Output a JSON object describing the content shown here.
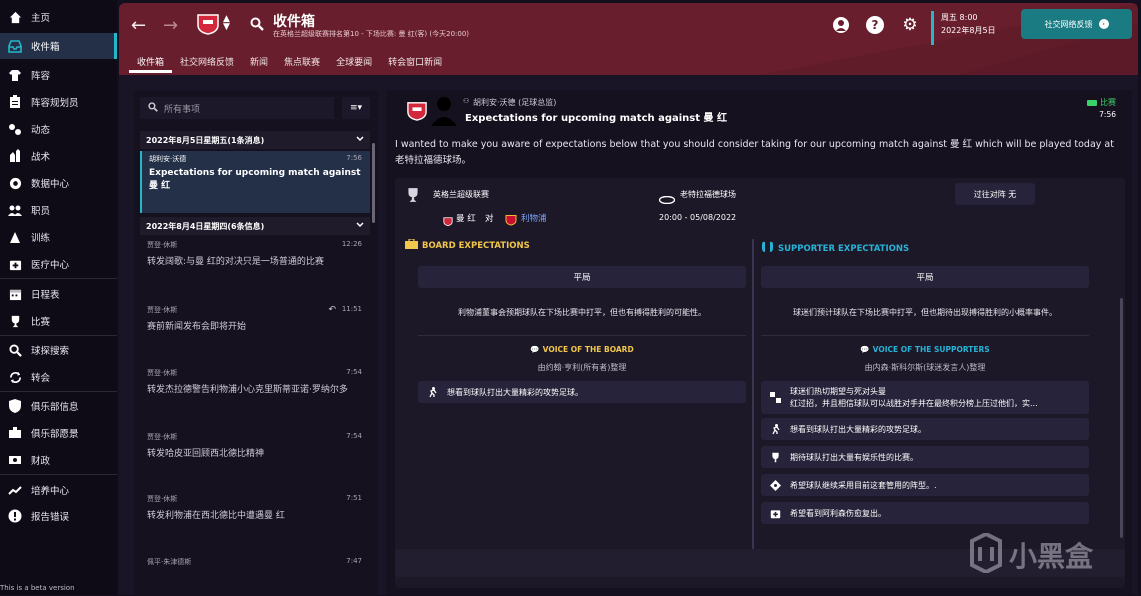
{
  "sidebar": {
    "items": [
      {
        "label": "主页",
        "icon": "home-icon"
      },
      {
        "label": "收件箱",
        "icon": "inbox-icon"
      },
      {
        "label": "阵容",
        "icon": "shirt-icon"
      },
      {
        "label": "阵容规划员",
        "icon": "clipboard-icon"
      },
      {
        "label": "动态",
        "icon": "dynamics-icon"
      },
      {
        "label": "战术",
        "icon": "tactics-icon"
      },
      {
        "label": "数据中心",
        "icon": "data-hub-icon"
      },
      {
        "label": "职员",
        "icon": "staff-icon"
      },
      {
        "label": "训练",
        "icon": "training-icon"
      },
      {
        "label": "医疗中心",
        "icon": "medical-icon"
      },
      {
        "label": "日程表",
        "icon": "calendar-icon"
      },
      {
        "label": "比赛",
        "icon": "trophy-icon"
      },
      {
        "label": "球探搜索",
        "icon": "search-icon"
      },
      {
        "label": "转会",
        "icon": "transfer-icon"
      },
      {
        "label": "俱乐部信息",
        "icon": "shield-icon"
      },
      {
        "label": "俱乐部愿景",
        "icon": "vision-icon"
      },
      {
        "label": "财政",
        "icon": "money-icon"
      },
      {
        "label": "培养中心",
        "icon": "development-icon"
      },
      {
        "label": "报告错误",
        "icon": "report-error-icon"
      }
    ],
    "beta": "This is a beta version"
  },
  "header": {
    "title": "收件箱",
    "subtitle": "在英格兰超级联赛排名第10 - 下场比赛: 曼 红(客) (今天20:00)",
    "tabs": [
      "收件箱",
      "社交网络反馈",
      "新闻",
      "焦点联赛",
      "全球要闻",
      "转会窗口新闻"
    ],
    "date_day": "周五 8:00",
    "date_full": "2022年8月5日",
    "feedback_button": "社交网络反馈"
  },
  "inbox": {
    "search_placeholder": "所有事项",
    "groups": [
      {
        "label": "2022年8月5日星期五(1条消息)"
      },
      {
        "label": "2022年8月4日星期四(6条信息)"
      }
    ],
    "items": [
      {
        "from": "胡利安·沃德",
        "time": "7:56",
        "text": "Expectations for upcoming match against 曼 红"
      },
      {
        "from": "贾登·休斯",
        "time": "12:26",
        "text": "转发阔歌:与曼 红的对决只是一场普通的比赛"
      },
      {
        "from": "贾登·休斯",
        "time": "11:51",
        "text": "赛前新闻发布会即将开始"
      },
      {
        "from": "贾登·休斯",
        "time": "7:54",
        "text": "转发杰拉德警告利物浦小心克里斯蒂亚诺·罗纳尔多"
      },
      {
        "from": "贾登·休斯",
        "time": "7:54",
        "text": "转发哈皮亚回顾西北德比精神"
      },
      {
        "from": "贾登·休斯",
        "time": "7:51",
        "text": "转发利物浦在西北德比中遭遇曼 红"
      },
      {
        "from": "佩平·朱津德斯",
        "time": "7:47",
        "text": ""
      }
    ]
  },
  "message": {
    "sender": "胡利安·沃德 (足球总监)",
    "subject": "Expectations for upcoming match against 曼 红",
    "tag": "比赛",
    "time": "7:56",
    "body": "I wanted to make you aware of expectations below that you should consider taking for our upcoming match against 曼 红 which will be played today at 老特拉福德球场。",
    "competition": "英格兰超级联赛",
    "venue": "老特拉福德球场",
    "home_team": "曼 红",
    "vs": "对",
    "away_team": "利物浦",
    "kickoff": "20:00 - 05/08/2022",
    "previous": "过往对阵 无",
    "board": {
      "title": "BOARD EXPECTATIONS",
      "expectation": "平局",
      "paragraph": "利物浦董事会预期球队在下场比赛中打平，但也有搏得胜利的可能性。",
      "voice_title": "VOICE OF THE BOARD",
      "voice_by": "由约翰·亨利(所有者)整理",
      "rows": [
        {
          "icon": "run-icon",
          "text": "想看到球队打出大量精彩的攻势足球。"
        }
      ]
    },
    "supporters": {
      "title": "SUPPORTER EXPECTATIONS",
      "expectation": "平局",
      "paragraph": "球迷们预计球队在下场比赛中打平，但也期待出现搏得胜利的小概率事件。",
      "voice_title": "VOICE OF THE SUPPORTERS",
      "voice_by": "由内森·斯科尔斯(球迷发言人)整理",
      "rows": [
        {
          "icon": "rivalry-icon",
          "text": "球迷们热切期望与死对头曼\n红过招，并且相信球队可以战胜对手并在最终积分榜上压过他们，实..."
        },
        {
          "icon": "run-icon",
          "text": "想看到球队打出大量精彩的攻势足球。"
        },
        {
          "icon": "trophy-hand-icon",
          "text": "期待球队打出大量有娱乐性的比赛。"
        },
        {
          "icon": "formation-icon",
          "text": "希望球队继续采用目前这套管用的阵型。."
        },
        {
          "icon": "medical-icon",
          "text": "希望看到阿利森伤愈复出。"
        }
      ]
    }
  },
  "watermark": "小黑盒",
  "colors": {
    "accent": "#25b7c9",
    "header": "#681e2d",
    "gold": "#f1c64b",
    "button": "#1a7b83"
  }
}
